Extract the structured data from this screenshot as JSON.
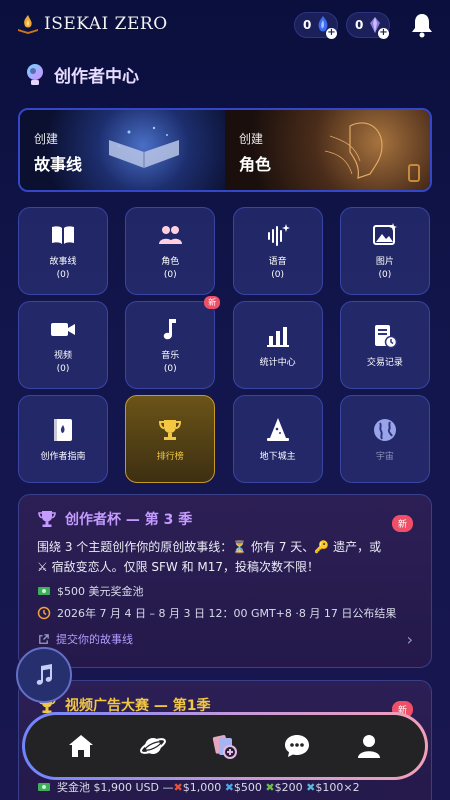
{
  "header": {
    "logo_text": "ISEKAI ZERO",
    "gem_blue_count": "0",
    "gem_purple_count": "0",
    "plus": "+"
  },
  "section_title": "创作者中心",
  "banner": {
    "left_small": "创建",
    "left_big": "故事线",
    "right_small": "创建",
    "right_big": "角色"
  },
  "tiles": [
    {
      "label": "故事线",
      "count": "(0)",
      "icon": "book-icon"
    },
    {
      "label": "角色",
      "count": "(0)",
      "icon": "users-icon"
    },
    {
      "label": "语音",
      "count": "(0)",
      "icon": "voice-icon"
    },
    {
      "label": "图片",
      "count": "(0)",
      "icon": "image-icon"
    },
    {
      "label": "视频",
      "count": "(0)",
      "icon": "video-icon"
    },
    {
      "label": "音乐",
      "count": "(0)",
      "icon": "music-note-icon",
      "badge": "新"
    },
    {
      "label": "统计中心",
      "icon": "bar-chart-icon"
    },
    {
      "label": "交易记录",
      "icon": "receipt-icon"
    },
    {
      "label": "创作者指南",
      "icon": "guide-icon"
    },
    {
      "label": "排行榜",
      "icon": "trophy-icon"
    },
    {
      "label": "地下城主",
      "icon": "wizard-hat-icon"
    },
    {
      "label": "宇宙",
      "icon": "globe-icon"
    }
  ],
  "card1": {
    "title": "创作者杯 — 第 3 季",
    "badge": "新",
    "desc_a": "围绕 3 个主题创作你的原创故事线：",
    "desc_b": " 你有 7 天、",
    "desc_c": " 遗产，或",
    "desc_d": " 宿敌变恋人。仅限 SFW 和 M17，投稿次数不限！",
    "prize": "$500 美元奖金池",
    "date": "2026年 7 月 4 日 – 8 月 3 日 12：00 GMT+8 ·8 月 17 日公布结果",
    "link": "提交你的故事线",
    "chevron": "›"
  },
  "card2": {
    "title": "视频广告大赛 — 第1季",
    "badge": "新",
    "prize_row": "奖金池 $1,900 USD — ",
    "p1": "$1,000",
    "p2": "$500",
    "p3": "$200",
    "p4": "$100×2"
  },
  "colors": {
    "accent_purple": "#c49bff",
    "gold": "#f2c744",
    "badge_red": "#ef4f67",
    "tile_border": "#3a44a3"
  }
}
